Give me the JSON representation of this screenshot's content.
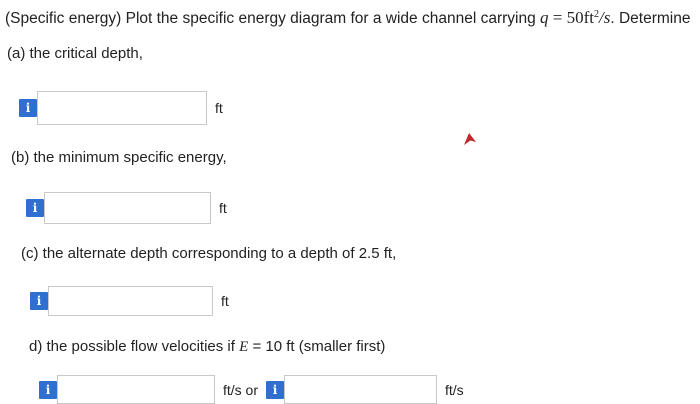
{
  "problem": {
    "intro": "(Specific energy) Plot the specific energy diagram for a wide channel carrying ",
    "var_q": "q",
    "equals": " = ",
    "value": "50",
    "unit_ft": "ft",
    "unit_exp": "2",
    "unit_rest": "/s",
    "tail": ". Determine"
  },
  "parts": [
    {
      "label": "(a) the critical depth,",
      "unit": "ft",
      "badge": "i"
    },
    {
      "label": "(b) the minimum specific energy,",
      "unit": "ft",
      "badge": "i"
    },
    {
      "label": "(c) the alternate depth corresponding to a depth of 2.5 ft,",
      "unit": "ft",
      "badge": "i"
    },
    {
      "label_pre": "d) the possible flow velocities if ",
      "label_var": "E",
      "label_post": " = 10 ft (smaller first)",
      "unit_first": "ft/s or",
      "unit_second": "ft/s",
      "badge": "i"
    }
  ],
  "icons": {
    "info": "info-badge-icon",
    "pointer": "mouse-pointer-icon"
  },
  "colors": {
    "badge": "#2f6fd0",
    "input_border": "#c8c8c8"
  }
}
